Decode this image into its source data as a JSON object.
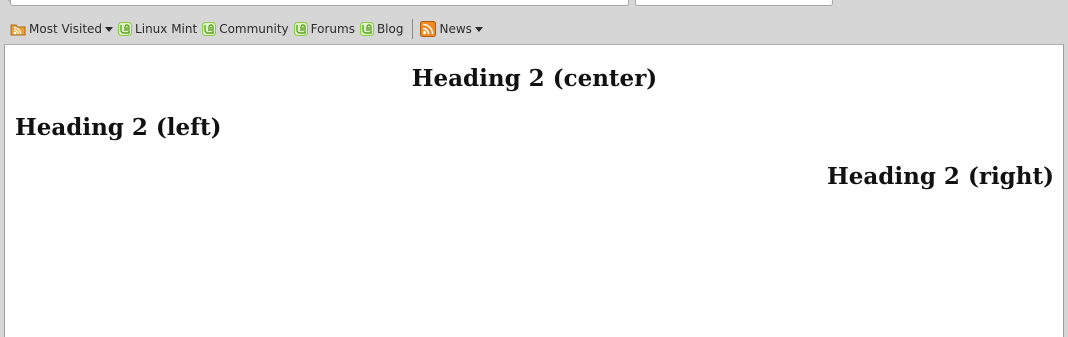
{
  "bookmarks": {
    "most_visited": "Most Visited",
    "linux_mint": "Linux Mint",
    "community": "Community",
    "forums": "Forums",
    "blog": "Blog",
    "news": "News"
  },
  "page": {
    "heading_center": "Heading 2 (center)",
    "heading_left": "Heading 2 (left)",
    "heading_right": "Heading 2 (right)"
  },
  "colors": {
    "toolbar_bg": "#d6d6d6",
    "mint_green": "#87cf3e",
    "feed_orange": "#f08a24"
  }
}
